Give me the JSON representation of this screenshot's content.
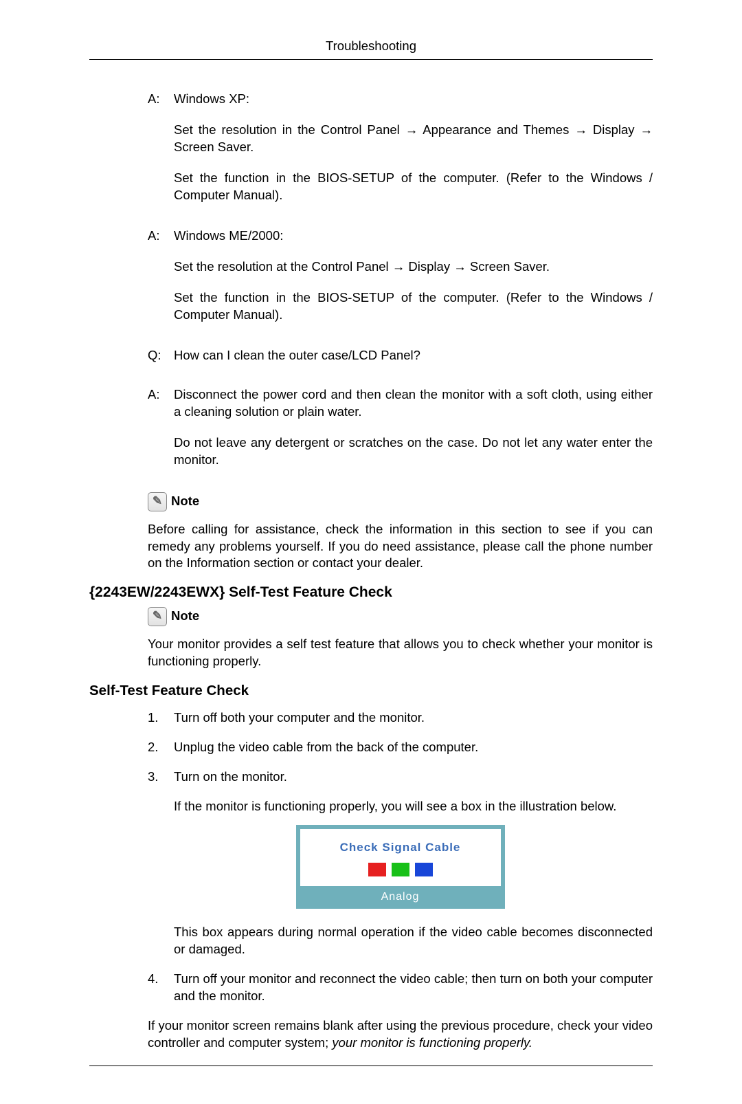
{
  "header": {
    "title": "Troubleshooting"
  },
  "qa": [
    {
      "label": "A:",
      "lines": [
        "Windows XP:",
        "Set the resolution in the Control Panel → Appearance and Themes → Display → Screen Saver.",
        "Set the function in the BIOS-SETUP of the computer. (Refer to the Windows / Computer Manual)."
      ]
    },
    {
      "label": "A:",
      "lines": [
        "Windows ME/2000:",
        "Set the resolution at the Control Panel → Display → Screen Saver.",
        "Set the function in the BIOS-SETUP of the computer. (Refer to the Windows / Computer Manual)."
      ]
    },
    {
      "label": "Q:",
      "lines": [
        "How can I clean the outer case/LCD Panel?"
      ]
    },
    {
      "label": "A:",
      "lines": [
        "Disconnect the power cord and then clean the monitor with a soft cloth, using either a cleaning solution or plain water.",
        "Do not leave any detergent or scratches on the case. Do not let any water enter the monitor."
      ]
    }
  ],
  "note1": {
    "label": "Note",
    "text": "Before calling for assistance, check the information in this section to see if you can remedy any problems yourself. If you do need assistance, please call the phone number on the Information section or contact your dealer."
  },
  "section1": {
    "heading": "{2243EW/2243EWX} Self-Test Feature Check",
    "note_label": "Note",
    "text": "Your monitor provides a self test feature that allows you to check whether your monitor is functioning properly."
  },
  "section2": {
    "heading": "Self-Test Feature Check",
    "steps": [
      {
        "n": "1.",
        "text": "Turn off both your computer and the monitor."
      },
      {
        "n": "2.",
        "text": "Unplug the video cable from the back of the computer."
      },
      {
        "n": "3.",
        "text": "Turn on the monitor.",
        "extra": "If the monitor is functioning properly, you will see a box in the illustration below."
      },
      {
        "n": "4.",
        "text": "Turn off your monitor and reconnect the video cable; then turn on both your computer and the monitor."
      }
    ],
    "post_box": "This box appears during normal operation if the video cable becomes disconnected or damaged.",
    "closing_pre": "If your monitor screen remains blank after using the previous procedure, check your video controller and computer system; ",
    "closing_italic": "your monitor is functioning properly."
  },
  "monitor_dialog": {
    "title": "Check Signal Cable",
    "colors": [
      "#e62020",
      "#18c018",
      "#1846d8"
    ],
    "label": "Analog"
  }
}
